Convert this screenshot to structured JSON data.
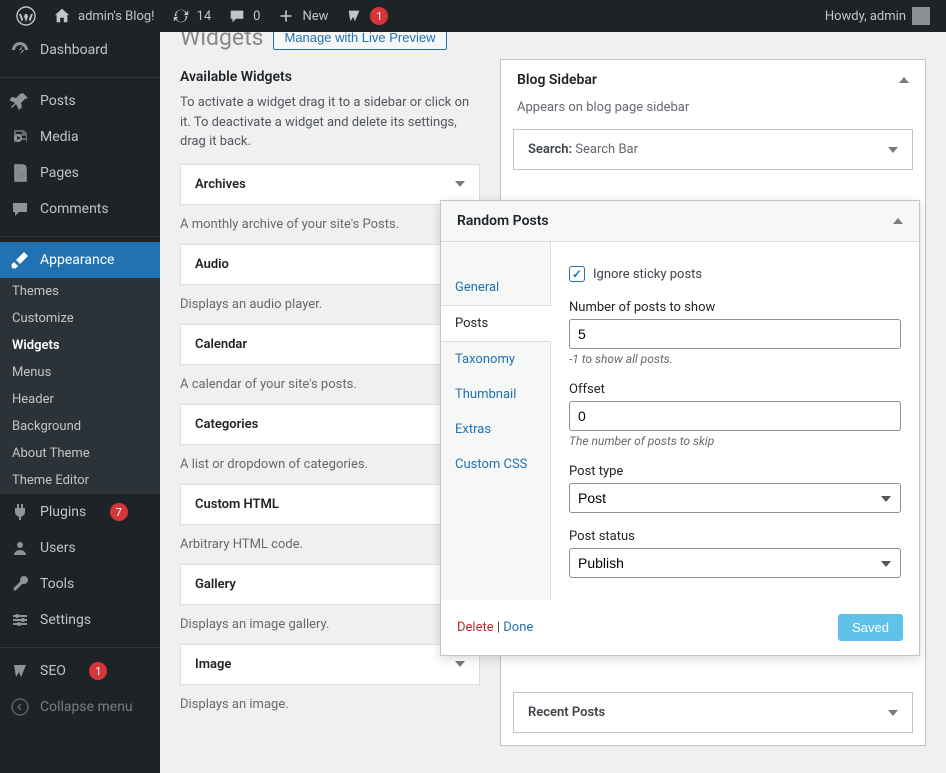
{
  "adminbar": {
    "site": "admin's Blog!",
    "updates": "14",
    "comments": "0",
    "new": "New",
    "notif": "1",
    "howdy": "Howdy, admin"
  },
  "menu": {
    "dashboard": "Dashboard",
    "posts": "Posts",
    "media": "Media",
    "pages": "Pages",
    "comments": "Comments",
    "appearance": "Appearance",
    "appearance_sub": {
      "themes": "Themes",
      "customize": "Customize",
      "widgets": "Widgets",
      "menus": "Menus",
      "header": "Header",
      "background": "Background",
      "about": "About Theme",
      "editor": "Theme Editor"
    },
    "plugins": "Plugins",
    "plugins_count": "7",
    "users": "Users",
    "tools": "Tools",
    "settings": "Settings",
    "seo": "SEO",
    "seo_count": "1",
    "collapse": "Collapse menu"
  },
  "page": {
    "title": "Widgets",
    "live_preview": "Manage with Live Preview"
  },
  "available": {
    "heading": "Available Widgets",
    "desc": "To activate a widget drag it to a sidebar or click on it. To deactivate a widget and delete its settings, drag it back.",
    "items": [
      {
        "name": "Archives",
        "desc": "A monthly archive of your site's Posts."
      },
      {
        "name": "Audio",
        "desc": "Displays an audio player."
      },
      {
        "name": "Calendar",
        "desc": "A calendar of your site's posts."
      },
      {
        "name": "Categories",
        "desc": "A list or dropdown of categories."
      },
      {
        "name": "Custom HTML",
        "desc": "Arbitrary HTML code."
      },
      {
        "name": "Gallery",
        "desc": "Displays an image gallery."
      },
      {
        "name": "Image",
        "desc": "Displays an image."
      }
    ]
  },
  "sidebar_area": {
    "title": "Blog Sidebar",
    "desc": "Appears on blog page sidebar",
    "search_label": "Search:",
    "search_value": "Search Bar",
    "recent": "Recent Posts"
  },
  "editor": {
    "title": "Random Posts",
    "tabs": {
      "general": "General",
      "posts": "Posts",
      "taxonomy": "Taxonomy",
      "thumbnail": "Thumbnail",
      "extras": "Extras",
      "css": "Custom CSS"
    },
    "form": {
      "ignore_sticky": "Ignore sticky posts",
      "num_label": "Number of posts to show",
      "num_value": "5",
      "num_hint": "-1 to show all posts.",
      "offset_label": "Offset",
      "offset_value": "0",
      "offset_hint": "The number of posts to skip",
      "type_label": "Post type",
      "type_value": "Post",
      "status_label": "Post status",
      "status_value": "Publish"
    },
    "footer": {
      "delete": "Delete",
      "sep": " | ",
      "done": "Done",
      "saved": "Saved"
    }
  }
}
